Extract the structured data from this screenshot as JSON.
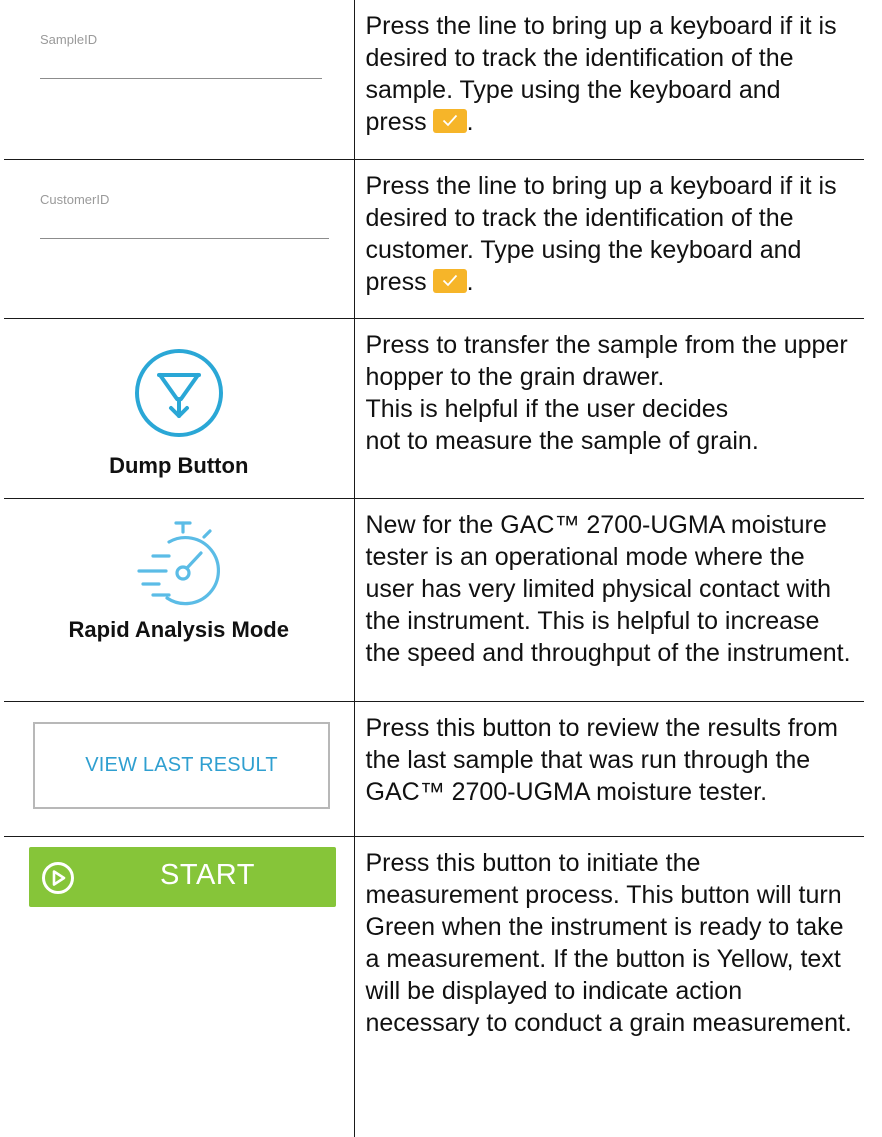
{
  "rows": [
    {
      "control": {
        "label": "SampleID"
      },
      "description": "Press the line to bring up a keyboard if it is desired to track the identification of the sample. Type using the keyboard and",
      "press_word": "press",
      "after_icon": "."
    },
    {
      "control": {
        "label": "CustomerID"
      },
      "description": "Press the line to bring up a keyboard if it is desired to track the identification of the customer. Type using the keyboard and",
      "press_word": "press",
      "after_icon": "."
    },
    {
      "control": {
        "caption": "Dump Button",
        "icon": "dump-funnel-icon"
      },
      "description": "Press to transfer the sample from the upper hopper to the grain drawer.\nThis is helpful if the user decides\nnot to measure the sample of grain."
    },
    {
      "control": {
        "caption": "Rapid Analysis Mode",
        "icon": "stopwatch-icon"
      },
      "description": "New for the GAC™ 2700-UGMA moisture tester is an operational mode where the user has very limited physical contact with the instrument. This is helpful to increase the speed and throughput of the instrument."
    },
    {
      "control": {
        "label": "VIEW LAST RESULT"
      },
      "description": "Press this button to review the results from the last sample that was run through the GAC™ 2700-UGMA moisture tester."
    },
    {
      "control": {
        "label": "START",
        "icon": "play-circle-icon"
      },
      "description": "Press this button to initiate the measurement process. This button will turn Green when the instrument is ready to take a measurement. If the button is Yellow, text will be displayed to indicate action necessary to conduct a grain measurement."
    }
  ],
  "colors": {
    "accent_blue": "#2aa7d6",
    "confirm_yellow": "#f6b529",
    "start_green": "#86c539"
  }
}
